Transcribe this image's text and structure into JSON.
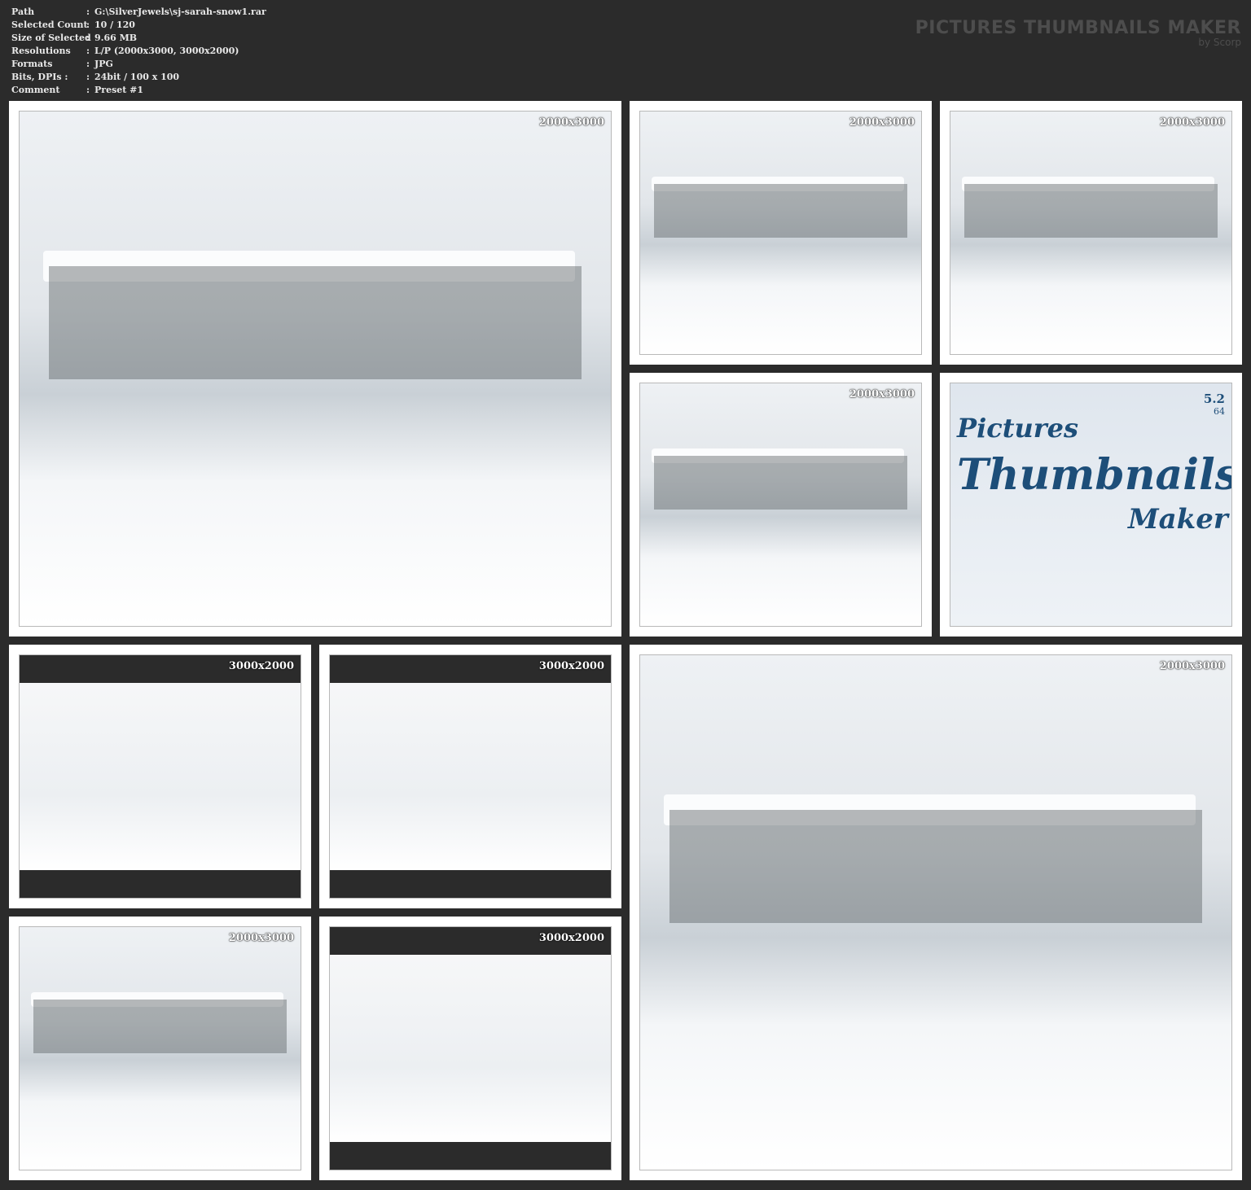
{
  "header": {
    "rows": [
      {
        "key": "Path",
        "value": "G:\\SilverJewels\\sj-sarah-snow1.rar"
      },
      {
        "key": "Selected Count",
        "value": "10 / 120"
      },
      {
        "key": "Size of Selected",
        "value": "9.66 MB"
      },
      {
        "key": "Resolutions",
        "value": "L/P (2000x3000, 3000x2000)"
      },
      {
        "key": "Formats",
        "value": "JPG"
      },
      {
        "key": "Bits, DPIs :",
        "value": "24bit / 100 x 100"
      },
      {
        "key": "Comment",
        "value": "Preset #1"
      }
    ],
    "separator": ":"
  },
  "brand": {
    "title": "PICTURES THUMBNAILS MAKER",
    "by": "by Scorp"
  },
  "thumbnails": [
    {
      "resolution": "2000x3000"
    },
    {
      "resolution": "2000x3000"
    },
    {
      "resolution": "2000x3000"
    },
    {
      "resolution": "2000x3000"
    },
    {
      "resolution": ""
    },
    {
      "resolution": "3000x2000"
    },
    {
      "resolution": "3000x2000"
    },
    {
      "resolution": "2000x3000"
    },
    {
      "resolution": "2000x3000"
    },
    {
      "resolution": "3000x2000"
    }
  ],
  "logo": {
    "word1": "Pictures",
    "word2": "Thumbnails",
    "word3": "Maker",
    "version": "5.2",
    "bits": "64"
  },
  "colors": {
    "background": "#2b2b2b",
    "card": "#ffffff",
    "brand": "#4d4d4d"
  }
}
